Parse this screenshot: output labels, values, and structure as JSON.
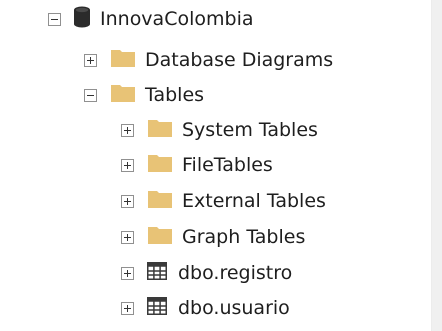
{
  "tree": {
    "root": {
      "label": "InnovaColombia",
      "icon": "database-icon",
      "expanded": true
    },
    "database_diagrams": {
      "label": "Database Diagrams",
      "icon": "folder-icon",
      "expanded": false
    },
    "tables": {
      "label": "Tables",
      "icon": "folder-icon",
      "expanded": true
    },
    "system_tables": {
      "label": "System Tables",
      "icon": "folder-icon",
      "expanded": false
    },
    "file_tables": {
      "label": "FileTables",
      "icon": "folder-icon",
      "expanded": false
    },
    "external_tables": {
      "label": "External Tables",
      "icon": "folder-icon",
      "expanded": false
    },
    "graph_tables": {
      "label": "Graph Tables",
      "icon": "folder-icon",
      "expanded": false
    },
    "registro": {
      "label": "dbo.registro",
      "icon": "table-grid-icon",
      "expanded": false
    },
    "usuario": {
      "label": "dbo.usuario",
      "icon": "table-grid-icon",
      "expanded": false
    }
  },
  "colors": {
    "folder": "#e8c376",
    "database": "#2b2b2b",
    "table_grid": "#3a3a3a",
    "toggle_border": "#909090",
    "text": "#1e1e1e"
  }
}
